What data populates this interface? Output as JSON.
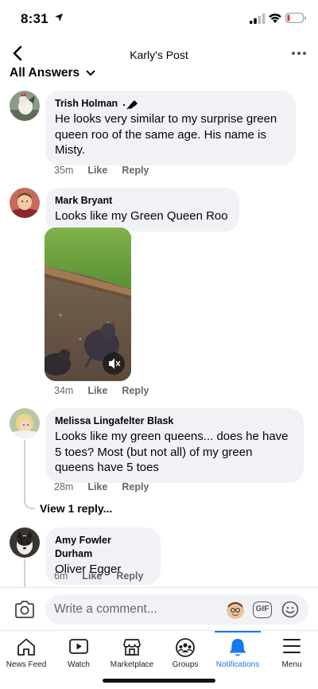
{
  "status_bar": {
    "time": "8:31"
  },
  "header": {
    "title": "Karly's Post"
  },
  "filter": {
    "label": "All Answers"
  },
  "comments": [
    {
      "author": "Trish Holman",
      "text": "He looks very similar to my surprise green queen roo of the same age. His name is Misty.",
      "time": "35m",
      "like": "Like",
      "reply": "Reply"
    },
    {
      "author": "Mark Bryant",
      "text": "Looks like my Green Queen Roo",
      "time": "34m",
      "like": "Like",
      "reply": "Reply"
    },
    {
      "author": "Melissa Lingafelter Blask",
      "text": "Looks like my green queens... does he have 5 toes? Most (but not all) of my green queens have 5 toes",
      "time": "28m",
      "like": "Like",
      "reply": "Reply"
    },
    {
      "author": "Amy Fowler Durham",
      "text": "Oliver Egger",
      "time": "6m",
      "like": "Like",
      "reply": "Reply"
    }
  ],
  "view_replies": "View 1 reply...",
  "composer": {
    "placeholder": "Write a comment...",
    "gif": "GIF"
  },
  "tabs": [
    {
      "label": "News Feed",
      "icon": "home-icon"
    },
    {
      "label": "Watch",
      "icon": "video-play-icon"
    },
    {
      "label": "Marketplace",
      "icon": "storefront-icon"
    },
    {
      "label": "Groups",
      "icon": "groups-icon"
    },
    {
      "label": "Notifications",
      "icon": "bell-icon",
      "active": true
    },
    {
      "label": "Menu",
      "icon": "hamburger-menu-icon"
    }
  ],
  "colors": {
    "accent": "#1877f2",
    "bubble": "#f0f2f5",
    "meta": "#65676b"
  }
}
